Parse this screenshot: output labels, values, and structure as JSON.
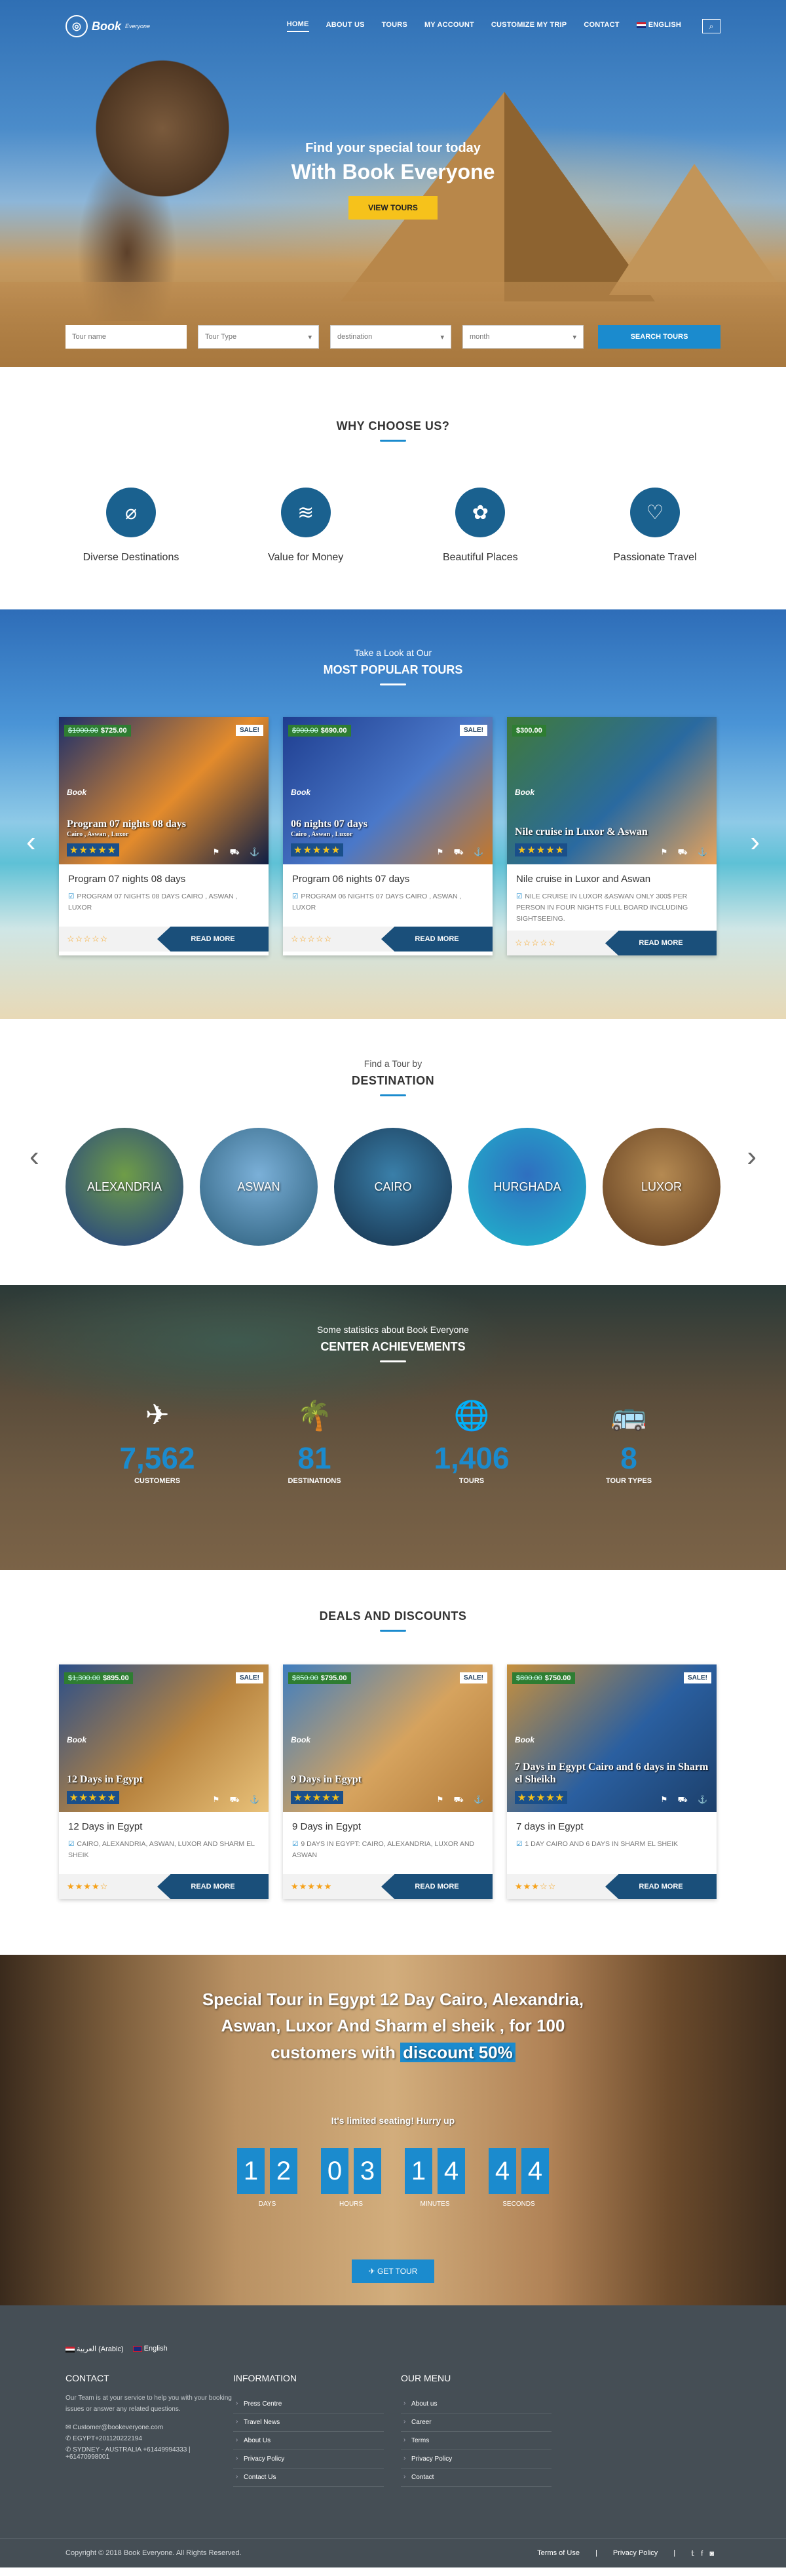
{
  "brand": {
    "name": "Book",
    "tag": "Everyone"
  },
  "nav": {
    "items": [
      "HOME",
      "ABOUT US",
      "TOURS",
      "MY ACCOUNT",
      "CUSTOMIZE MY TRIP",
      "CONTACT"
    ],
    "language": "ENGLISH"
  },
  "hero": {
    "sub": "Find your special tour today",
    "main": "With Book Everyone",
    "button": "VIEW TOURS"
  },
  "search": {
    "name_placeholder": "Tour name",
    "type": "Tour Type",
    "destination": "destination",
    "month": "month",
    "button": "SEARCH TOURS"
  },
  "why": {
    "title": "WHY CHOOSE US?",
    "items": [
      "Diverse Destinations",
      "Value for Money",
      "Beautiful Places",
      "Passionate Travel"
    ]
  },
  "popular": {
    "eyebrow": "Take a Look at Our",
    "title": "MOST POPULAR TOURS",
    "cards": [
      {
        "old_price": "$1000.00",
        "price": "$725.00",
        "sale": "SALE!",
        "img_title": "Program 07 nights 08 days",
        "img_sub": "Cairo , Aswan , Luxor",
        "title": "Program 07 nights 08 days",
        "desc": "PROGRAM 07 NIGHTS 08 DAYS CAIRO , ASWAN , LUXOR",
        "more": "READ MORE",
        "colors": [
          "#1c2f6b",
          "#e38b2c",
          "#0f1f45"
        ]
      },
      {
        "old_price": "$900.00",
        "price": "$690.00",
        "sale": "SALE!",
        "img_title": "06 nights 07 days",
        "img_sub": "Cairo , Aswan , Luxor",
        "title": "Program 06 nights 07 days",
        "desc": "PROGRAM 06 NIGHTS 07 DAYS CAIRO , ASWAN , LUXOR",
        "more": "READ MORE",
        "colors": [
          "#1e3d8f",
          "#4a78c9",
          "#c77828"
        ]
      },
      {
        "old_price": "",
        "price": "$300.00",
        "sale": "",
        "img_title": "Nile cruise in Luxor & Aswan",
        "img_sub": "",
        "title": "Nile cruise in Luxor and Aswan",
        "desc": "NILE CRUISE IN LUXOR &ASWAN ONLY 300$ PER PERSON IN FOUR NIGHTS FULL BOARD INCLUDING SIGHTSEEING.",
        "more": "READ MORE",
        "colors": [
          "#3f7a3a",
          "#2a6aa0",
          "#e9a35a"
        ]
      }
    ]
  },
  "destination": {
    "eyebrow": "Find a Tour by",
    "title": "DESTINATION",
    "items": [
      {
        "name": "ALEXANDRIA",
        "c1": "#6f9d47",
        "c2": "#2f4f7a"
      },
      {
        "name": "ASWAN",
        "c1": "#7bb0d8",
        "c2": "#3a6d8c"
      },
      {
        "name": "CAIRO",
        "c1": "#3a7fa9",
        "c2": "#1c3f5c"
      },
      {
        "name": "HURGHADA",
        "c1": "#2f6fc0",
        "c2": "#22a9c9"
      },
      {
        "name": "LUXOR",
        "c1": "#b58a52",
        "c2": "#6f4a28"
      }
    ]
  },
  "achievements": {
    "eyebrow": "Some statistics about Book Everyone",
    "title": "CENTER ACHIEVEMENTS",
    "stats": [
      {
        "icon": "✈",
        "num": "7,562",
        "label": "CUSTOMERS"
      },
      {
        "icon": "🌴",
        "num": "81",
        "label": "DESTINATIONS"
      },
      {
        "icon": "🌐",
        "num": "1,406",
        "label": "TOURS"
      },
      {
        "icon": "🚌",
        "num": "8",
        "label": "TOUR TYPES"
      }
    ]
  },
  "deals": {
    "title": "DEALS AND DISCOUNTS",
    "cards": [
      {
        "old_price": "$1,300.00",
        "price": "$895.00",
        "sale": "SALE!",
        "img_title": "12 Days in Egypt",
        "img_sub": "",
        "title": "12 Days in Egypt",
        "desc": "CAIRO, ALEXANDRIA, ASWAN, LUXOR AND SHARM EL SHEIK",
        "more": "READ MORE",
        "colors": [
          "#2b4f8a",
          "#b8843f",
          "#e9c27a"
        ]
      },
      {
        "old_price": "$850.00",
        "price": "$795.00",
        "sale": "SALE!",
        "img_title": "9 Days in Egypt",
        "img_sub": "",
        "title": "9 Days in Egypt",
        "desc": "9 DAYS IN EGYPT: CAIRO, ALEXANDRIA, LUXOR AND ASWAN",
        "more": "READ MORE",
        "colors": [
          "#3f7ec0",
          "#d6a35e",
          "#b07a3a"
        ]
      },
      {
        "old_price": "$800.00",
        "price": "$750.00",
        "sale": "SALE!",
        "img_title": "7 Days in Egypt Cairo and 6 days in Sharm el Sheikh",
        "img_sub": "",
        "title": "7 days in Egypt",
        "desc": "1 DAY CAIRO AND 6 DAYS IN SHARM EL SHEIK",
        "more": "READ MORE",
        "colors": [
          "#c7903d",
          "#2a5fa0",
          "#1c3f6a"
        ]
      }
    ],
    "ratings": [
      4,
      5,
      3
    ]
  },
  "special": {
    "title_a": "Special Tour in Egypt 12 Day Cairo, Alexandria, Aswan, Luxor And Sharm el sheik , for 100 customers with",
    "title_hl": "discount 50%",
    "note": "It's limited seating! Hurry up",
    "countdown": [
      {
        "digits": [
          "1",
          "2"
        ],
        "label": "DAYS"
      },
      {
        "digits": [
          "0",
          "3"
        ],
        "label": "HOURS"
      },
      {
        "digits": [
          "1",
          "4"
        ],
        "label": "MINUTES"
      },
      {
        "digits": [
          "4",
          "4"
        ],
        "label": "SECONDS"
      }
    ],
    "button": "GET TOUR"
  },
  "footer": {
    "lang_ar": "العربية (Arabic)",
    "lang_en": "English",
    "contact": {
      "title": "CONTACT",
      "text": "Our Team is at your service to help you with your booking issues or answer any related questions.",
      "email": "Customer@bookeveryone.com",
      "phone": "EGYPT+201120222194",
      "sydney": "SYDNEY - AUSTRALIA +61449994333 | +61470998001"
    },
    "info": {
      "title": "INFORMATION",
      "links": [
        "Press Centre",
        "Travel News",
        "About Us",
        "Privacy Policy",
        "Contact Us"
      ]
    },
    "menu": {
      "title": "OUR MENU",
      "links": [
        "About us",
        "Career",
        "Terms",
        "Privacy Policy",
        "Contact"
      ]
    },
    "copyright": "Copyright © 2018 Book Everyone. All Rights Reserved.",
    "terms": "Terms of Use",
    "privacy": "Privacy Policy"
  }
}
